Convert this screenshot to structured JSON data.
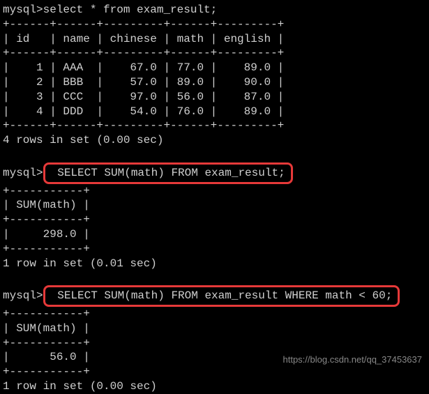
{
  "prompt": "mysql>",
  "query1": " select * from exam_result;",
  "table1": {
    "border_top": "+------+------+---------+------+---------+",
    "header": "| id   | name | chinese | math | english |",
    "border_mid": "+------+------+---------+------+---------+",
    "rows": [
      "|    1 | AAA  |    67.0 | 77.0 |    89.0 |",
      "|    2 | BBB  |    57.0 | 89.0 |    90.0 |",
      "|    3 | CCC  |    97.0 | 56.0 |    87.0 |",
      "|    4 | DDD  |    54.0 | 76.0 |    89.0 |"
    ],
    "border_bot": "+------+------+---------+------+---------+",
    "status": "4 rows in set (0.00 sec)"
  },
  "query2": " SELECT SUM(math) FROM exam_result;",
  "table2": {
    "border_top": "+-----------+",
    "header": "| SUM(math) |",
    "border_mid": "+-----------+",
    "row": "|     298.0 |",
    "border_bot": "+-----------+",
    "status": "1 row in set (0.01 sec)"
  },
  "query3": " SELECT SUM(math) FROM exam_result WHERE math < 60;",
  "table3": {
    "border_top": "+-----------+",
    "header": "| SUM(math) |",
    "border_mid": "+-----------+",
    "row": "|      56.0 |",
    "border_bot": "+-----------+",
    "status": "1 row in set (0.00 sec)"
  },
  "watermark": "https://blog.csdn.net/qq_37453637",
  "chart_data": [
    {
      "type": "table",
      "title": "exam_result",
      "columns": [
        "id",
        "name",
        "chinese",
        "math",
        "english"
      ],
      "rows": [
        [
          1,
          "AAA",
          67.0,
          77.0,
          89.0
        ],
        [
          2,
          "BBB",
          57.0,
          89.0,
          90.0
        ],
        [
          3,
          "CCC",
          97.0,
          56.0,
          87.0
        ],
        [
          4,
          "DDD",
          54.0,
          76.0,
          89.0
        ]
      ]
    },
    {
      "type": "table",
      "title": "SUM(math) FROM exam_result",
      "columns": [
        "SUM(math)"
      ],
      "rows": [
        [
          298.0
        ]
      ]
    },
    {
      "type": "table",
      "title": "SUM(math) FROM exam_result WHERE math < 60",
      "columns": [
        "SUM(math)"
      ],
      "rows": [
        [
          56.0
        ]
      ]
    }
  ]
}
